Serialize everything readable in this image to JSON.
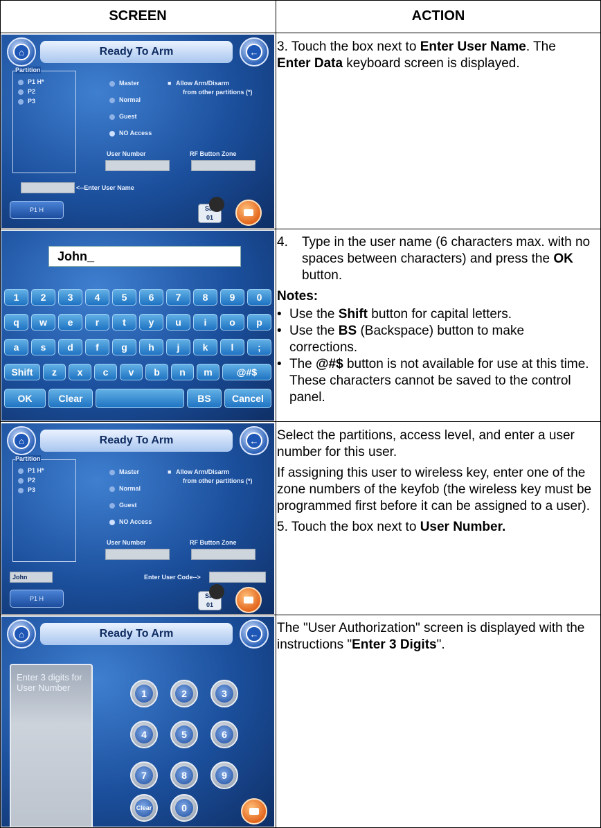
{
  "header": {
    "screen": "SCREEN",
    "action": "ACTION"
  },
  "row1": {
    "screen": {
      "title": "Ready To Arm",
      "partition_label": "Partition",
      "partitions": [
        "P1 H*",
        "P2",
        "P3"
      ],
      "levels": [
        "Master",
        "Normal",
        "Guest",
        "NO Access"
      ],
      "allow_label": "Allow Arm/Disarm",
      "allow_label2": "from other partitions (*)",
      "user_number_label": "User Number",
      "rf_label": "RF Button Zone",
      "enter_user_name": "<--Enter User Name",
      "p1h": "P1 H",
      "date_day": "Sat",
      "date_num": "01"
    },
    "action": {
      "pre1": "3.  Touch the box next to ",
      "bold1": "Enter User Name",
      "mid": ". The ",
      "bold2": "Enter Data",
      "post": " keyboard screen is displayed."
    }
  },
  "row2": {
    "screen": {
      "input_value": "John_",
      "row_digits": [
        "1",
        "2",
        "3",
        "4",
        "5",
        "6",
        "7",
        "8",
        "9",
        "0"
      ],
      "row_q": [
        "q",
        "w",
        "e",
        "r",
        "t",
        "y",
        "u",
        "i",
        "o",
        "p"
      ],
      "row_a": [
        "a",
        "s",
        "d",
        "f",
        "g",
        "h",
        "j",
        "k",
        "l",
        ";"
      ],
      "row_z": [
        "Shift",
        "z",
        "x",
        "c",
        "v",
        "b",
        "n",
        "m",
        "@#$"
      ],
      "bottom": {
        "ok": "OK",
        "clear": "Clear",
        "bs": "BS",
        "cancel": "Cancel"
      }
    },
    "action": {
      "step_num": "4.",
      "step_pre": "Type in the user name (6 characters max. with no spaces between characters) and press the ",
      "step_bold": "OK",
      "step_post": " button.",
      "notes_label": "Notes:",
      "note1_pre": "Use the ",
      "note1_bold": "Shift",
      "note1_post": " button for capital letters.",
      "note2_pre": "Use the ",
      "note2_bold": "BS",
      "note2_post": " (Backspace) button to make corrections.",
      "note3_pre": "The ",
      "note3_bold": "@#$",
      "note3_post": " button is not available for use at this time. These characters cannot be saved to the control panel."
    }
  },
  "row3": {
    "screen": {
      "title": "Ready To Arm",
      "partition_label": "Partition",
      "partitions": [
        "P1 H*",
        "P2",
        "P3"
      ],
      "levels": [
        "Master",
        "Normal",
        "Guest",
        "NO Access"
      ],
      "allow_label": "Allow Arm/Disarm",
      "allow_label2": "from other partitions (*)",
      "user_number_label": "User Number",
      "rf_label": "RF Button Zone",
      "user_name_value": "John",
      "enter_user_code": "Enter User Code-->",
      "p1h": "P1 H",
      "date_day": "Sat",
      "date_num": "01"
    },
    "action": {
      "para1": "Select the partitions, access level, and enter a user number for this user.",
      "para2": "If assigning this user to wireless key, enter one of the zone numbers of the keyfob (the wireless key must be programmed first before it can be assigned to a user).",
      "para3_pre": "5. Touch the box next to ",
      "para3_bold": "User Number."
    }
  },
  "row4": {
    "screen": {
      "title": "Ready To Arm",
      "prompt": "Enter 3 digits for User Number",
      "keys": [
        "1",
        "2",
        "3",
        "4",
        "5",
        "6",
        "7",
        "8",
        "9",
        "Clear",
        "0"
      ]
    },
    "action": {
      "pre": "The \"User Authorization\" screen is displayed with the instructions \"",
      "bold": "Enter 3 Digits",
      "post": "\"."
    }
  }
}
